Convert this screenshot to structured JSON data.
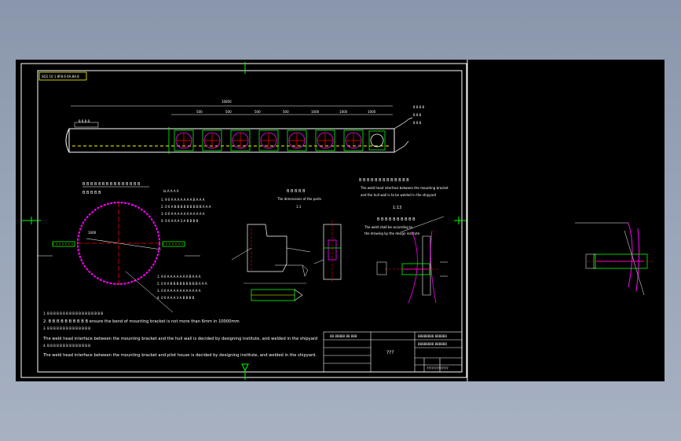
{
  "drawing": {
    "title_tag": "SQ1 10 1 8F8.6 6A.8A.8",
    "top_dimension": "10850",
    "segment_dims": [
      "500",
      "500",
      "500",
      "500",
      "1000",
      "1000",
      "1000"
    ],
    "side_note": "8 8 8 8",
    "section_heading": "B B B B 8 B B B B B B B B B B",
    "section_subheading": "B B B B B",
    "section_dim": "1000",
    "notes_header": "Ia A A A A",
    "note_lines": [
      "1. 9 0 A A A A A A A B A A A",
      "2. 0 0 A B B B B B B B B B A A A",
      "3. 0 0 A A A A A A A A A A A",
      "4. 0 0 A A A 3 A B B B B"
    ],
    "detail_title": "B B B B B",
    "detail_caption": "The dimensions of the parts",
    "detail_scale": "1:1",
    "weld_head": "B B B B B  B B B B B  B B B",
    "weld_text_1": "The weld head interface between the mounting bracket",
    "weld_text_2": "and the hull wall is to be welded in the shipyard",
    "weld_scale": "1:13",
    "weld_note_title": "B B B B B  B B B B B",
    "weld_note_1": "The weld shall be according to",
    "weld_note_2": "the drawing by the design institute",
    "lower_notes_cn": "1. B B B B B B B B B B B B B B B B B B",
    "note_bent": "2. B B B B B B B B B B  ensure the bend of mounting bracket is not more than 6mm in 10000mm",
    "note_weld_hull_cn": "3. B B B B B B B B B B B B B B",
    "note_weld_hull": "The weld head interface between the mounting bracket and the hull wall is decided by designing institute, and welded in the shipyard",
    "note_weld_cn": "4. B B B B B B B B B B B B B B",
    "note_weld_deck": "The weld head interface between the mounting bracket and pilot house is decided by designing institute, and welded in the shipyard.",
    "title_block_name": "???",
    "title_block_code": "?????????????",
    "title_block_heading": "88 88888 88 888"
  },
  "colors": {
    "background_outer": "#8a96ab",
    "canvas": "#000000",
    "frame": "#ffffff",
    "crosshair": "#00ff00",
    "accent_magenta": "#ff00ff",
    "accent_yellow": "#ffff00",
    "accent_red": "#ff0000",
    "accent_cyan": "#00ffff"
  }
}
